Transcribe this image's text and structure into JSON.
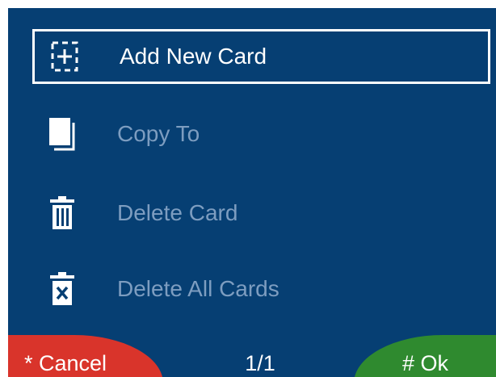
{
  "menu": {
    "items": [
      {
        "label": "Add New Card",
        "icon": "add-card-icon",
        "selected": true
      },
      {
        "label": "Copy To",
        "icon": "copy-icon",
        "selected": false
      },
      {
        "label": "Delete Card",
        "icon": "trash-icon",
        "selected": false
      },
      {
        "label": "Delete All Cards",
        "icon": "delete-all-icon",
        "selected": false
      }
    ]
  },
  "softkeys": {
    "cancel_label": "* Cancel",
    "ok_label": "# Ok"
  },
  "page_indicator": "1/1",
  "colors": {
    "background": "#063f73",
    "selected_text": "#ffffff",
    "disabled_text": "#7d9dc0",
    "cancel": "#d9342b",
    "ok": "#2f8a2f"
  }
}
